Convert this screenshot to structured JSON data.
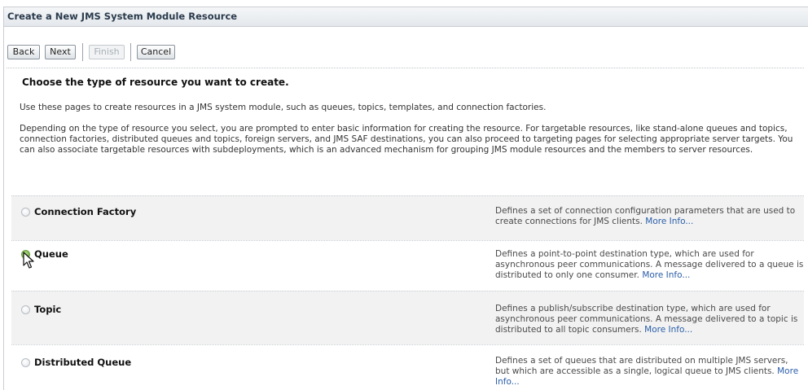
{
  "header": {
    "title": "Create a New JMS System Module Resource"
  },
  "toolbar": {
    "back_label": "Back",
    "next_label": "Next",
    "finish_label": "Finish",
    "cancel_label": "Cancel"
  },
  "content": {
    "heading": "Choose the type of resource you want to create.",
    "intro": "Use these pages to create resources in a JMS system module, such as queues, topics, templates, and connection factories.",
    "details": "Depending on the type of resource you select, you are prompted to enter basic information for creating the resource. For targetable resources, like stand-alone queues and topics, connection factories, distributed queues and topics, foreign servers, and JMS SAF destinations, you can also proceed to targeting pages for selecting appropriate server targets. You can also associate targetable resources with subdeployments, which is an advanced mechanism for grouping JMS module resources and the members to server resources."
  },
  "options": [
    {
      "label": "Connection Factory",
      "description": "Defines a set of connection configuration parameters that are used to create connections for JMS clients.",
      "more": "More Info...",
      "selected": false
    },
    {
      "label": "Queue",
      "description": "Defines a point-to-point destination type, which are used for asynchronous peer communications. A message delivered to a queue is distributed to only one consumer.",
      "more": "More Info...",
      "selected": true
    },
    {
      "label": "Topic",
      "description": "Defines a publish/subscribe destination type, which are used for asynchronous peer communications. A message delivered to a topic is distributed to all topic consumers.",
      "more": "More Info...",
      "selected": false
    },
    {
      "label": "Distributed Queue",
      "description": "Defines a set of queues that are distributed on multiple JMS servers, but which are accessible as a single, logical queue to JMS clients.",
      "more": "More Info...",
      "selected": false
    }
  ],
  "colors": {
    "selected_radio": "#5e9e2e",
    "link": "#2a5ea8",
    "row_shade": "#f2f2f2"
  }
}
